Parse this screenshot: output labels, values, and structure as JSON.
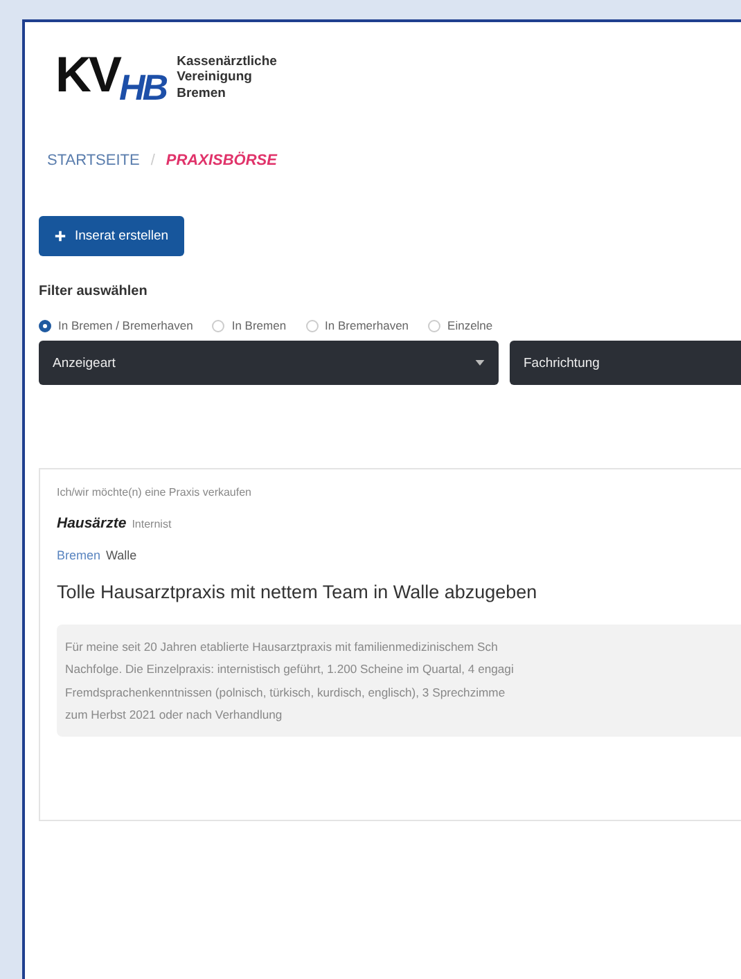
{
  "logo": {
    "mark_main": "KV",
    "mark_sub": "HB",
    "name_lines": [
      "Kassenärztliche",
      "Vereinigung",
      "Bremen"
    ]
  },
  "breadcrumb": {
    "items": [
      {
        "label": "STARTSEITE",
        "selected": false
      },
      {
        "label": "PRAXISBÖRSE",
        "selected": true
      }
    ],
    "separator": "/"
  },
  "create_button": {
    "label": "Inserat erstellen"
  },
  "filter": {
    "heading": "Filter auswählen",
    "regions": [
      {
        "label": "In Bremen / Bremerhaven",
        "selected": true
      },
      {
        "label": "In Bremen",
        "selected": false
      },
      {
        "label": "In Bremerhaven",
        "selected": false
      },
      {
        "label": "Einzelne",
        "selected": false
      }
    ],
    "selects": [
      {
        "label": "Anzeigeart"
      },
      {
        "label": "Fachrichtung"
      }
    ]
  },
  "listing": {
    "type_line": "Ich/wir möchte(n) eine Praxis verkaufen",
    "specialty": "Hausärzte",
    "subspecialty": "Internist",
    "city": "Bremen",
    "district": "Walle",
    "title": "Tolle Hausarztpraxis mit nettem Team in Walle abzugeben",
    "description_lines": [
      "Für meine seit 20 Jahren etablierte Hausarztpraxis mit familienmedizinischem Sch",
      "Nachfolge. Die Einzelpraxis: internistisch geführt, 1.200 Scheine im Quartal, 4 engagi",
      "Fremdsprachenkenntnissen (polnisch, türkisch, kurdisch, englisch), 3 Sprechzimme",
      "zum Herbst 2021 oder nach Verhandlung"
    ]
  }
}
